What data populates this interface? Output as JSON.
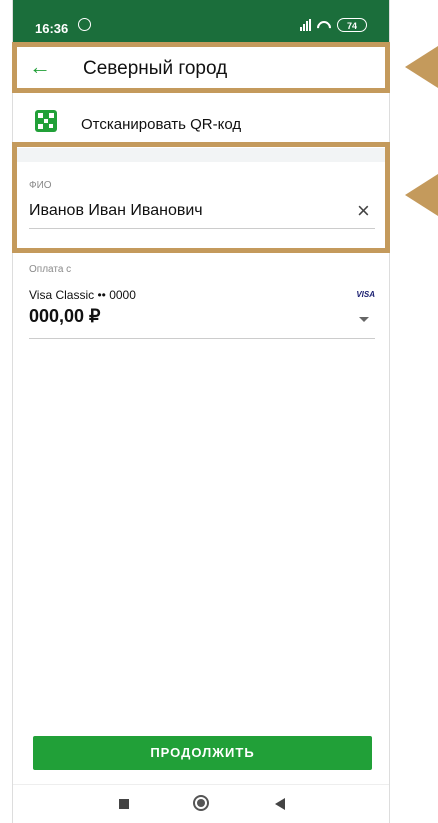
{
  "status_bar": {
    "time": "16:36",
    "battery": "74"
  },
  "header": {
    "title": "Северный город"
  },
  "qr": {
    "label": "Отсканировать QR-код"
  },
  "fio": {
    "label": "ФИО",
    "value": "Иванов Иван Иванович",
    "clear_icon": "×"
  },
  "payment": {
    "label": "Оплата с",
    "card": "Visa Classic •• 0000",
    "brand": "VISA",
    "amount": "000,00 ₽"
  },
  "continue_button": {
    "label": "ПРОДОЛЖИТЬ"
  },
  "colors": {
    "status_bar": "#1b6e3b",
    "accent": "#21a038",
    "annotation": "#c49a5c"
  },
  "icons": {
    "back": "arrow-left-icon",
    "qr": "qr-code-icon",
    "clear": "close-icon",
    "dropdown": "chevron-down-icon"
  }
}
